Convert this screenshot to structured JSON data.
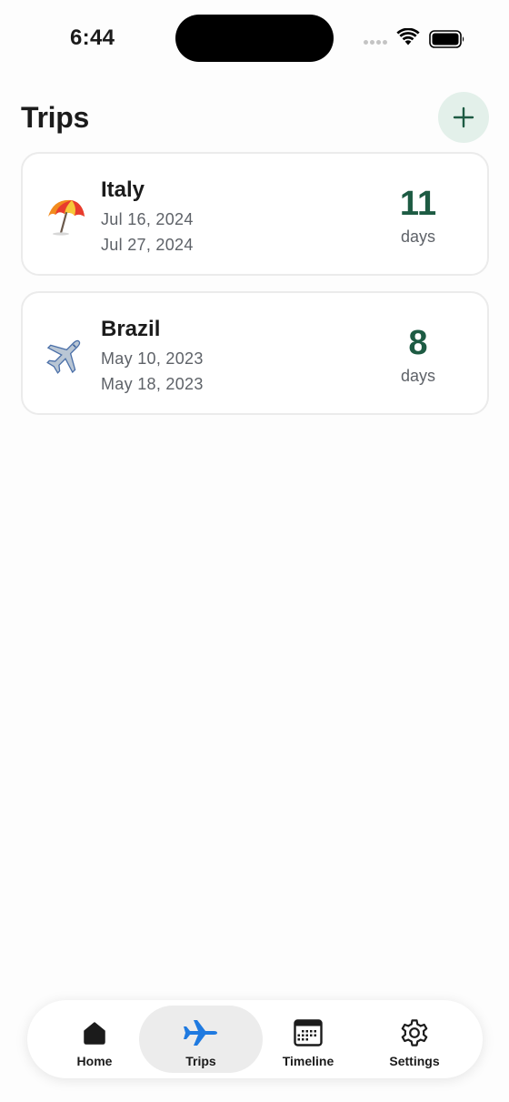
{
  "status_bar": {
    "time": "6:44"
  },
  "header": {
    "title": "Trips",
    "add_icon": "plus-icon"
  },
  "trips": [
    {
      "name": "Italy",
      "icon": "beach-umbrella-emoji",
      "start": "Jul 16, 2024",
      "end": "Jul 27, 2024",
      "days": "11",
      "days_unit": "days"
    },
    {
      "name": "Brazil",
      "icon": "airplane-emoji",
      "start": "May 10, 2023",
      "end": "May 18, 2023",
      "days": "8",
      "days_unit": "days"
    }
  ],
  "tab_bar": {
    "active": "Trips",
    "tabs": [
      {
        "label": "Home",
        "icon": "house-icon"
      },
      {
        "label": "Trips",
        "icon": "airplane-icon"
      },
      {
        "label": "Timeline",
        "icon": "calendar-icon"
      },
      {
        "label": "Settings",
        "icon": "gear-icon"
      }
    ]
  },
  "colors": {
    "accent_green": "#1d5b43",
    "add_button_bg": "#e3f0ea",
    "tab_active": "#1f7ae0",
    "secondary_text": "#5e6268"
  }
}
